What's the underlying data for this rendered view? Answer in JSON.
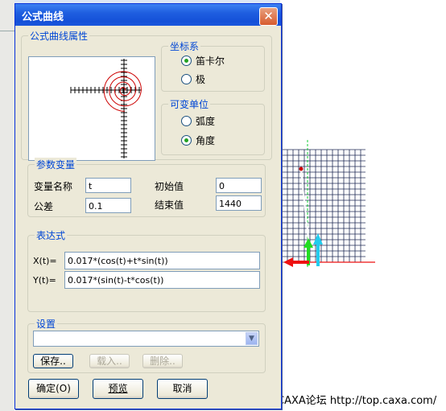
{
  "dialog": {
    "title": "公式曲线",
    "close_glyph": "✕"
  },
  "curve_props": {
    "legend": "公式曲线属性"
  },
  "coord_system": {
    "legend": "坐标系",
    "options": [
      {
        "label": "笛卡尔",
        "selected": true
      },
      {
        "label": "极",
        "selected": false
      }
    ]
  },
  "var_unit": {
    "legend": "可变单位",
    "options": [
      {
        "label": "弧度",
        "selected": false
      },
      {
        "label": "角度",
        "selected": true
      }
    ]
  },
  "params": {
    "legend": "参数变量",
    "var_name_label": "变量名称",
    "var_name_value": "t",
    "tolerance_label": "公差",
    "tolerance_value": "0.1",
    "start_label": "初始值",
    "start_value": "0",
    "end_label": "结束值",
    "end_value": "1440"
  },
  "expr": {
    "legend": "表达式",
    "x_label": "X(t)=",
    "x_value": "0.017*(cos(t)+t*sin(t))",
    "y_label": "Y(t)=",
    "y_value": "0.017*(sin(t)-t*cos(t))"
  },
  "settings": {
    "legend": "设置",
    "combo_value": "",
    "save_label": "保存..",
    "load_label": "载入..",
    "delete_label": "删除.."
  },
  "footer": {
    "ok_label": "确定(O)",
    "preview_label": "预览",
    "cancel_label": "取消"
  },
  "watermark": "CAXA论坛 http://top.caxa.com/",
  "colors": {
    "title_bar": "#1f5fe0",
    "legend_text": "#0046d5",
    "curve": "#cc0000",
    "grid": "#1f2a55",
    "axis_x": "#ee1111",
    "axis_y": "#11cc33",
    "axis_z": "#11ccee"
  }
}
